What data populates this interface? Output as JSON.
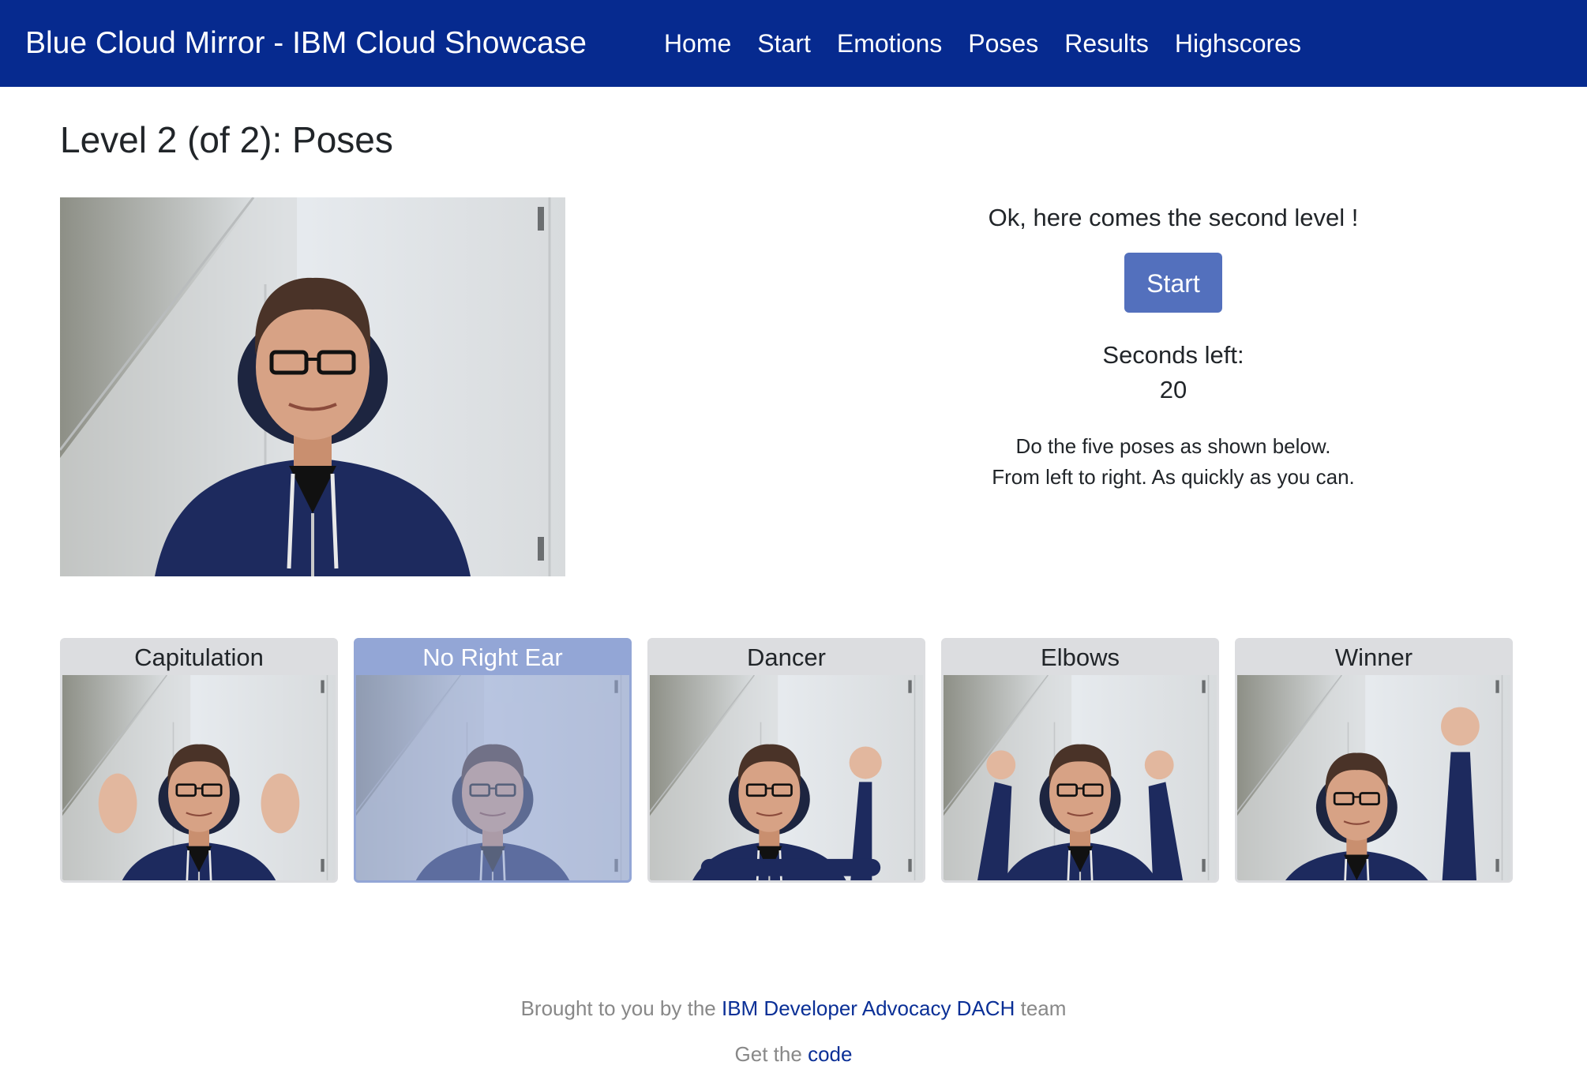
{
  "navbar": {
    "brand": "Blue Cloud Mirror - IBM Cloud Showcase",
    "links": [
      "Home",
      "Start",
      "Emotions",
      "Poses",
      "Results",
      "Highscores"
    ]
  },
  "page": {
    "title": "Level 2 (of 2): Poses"
  },
  "game": {
    "intro": "Ok, here comes the second level !",
    "start_label": "Start",
    "seconds_label": "Seconds left:",
    "seconds_value": "20",
    "instructions_line1": "Do the five poses as shown below.",
    "instructions_line2": "From left to right. As quickly as you can."
  },
  "poses": [
    {
      "label": "Capitulation",
      "active": false
    },
    {
      "label": "No Right Ear",
      "active": true
    },
    {
      "label": "Dancer",
      "active": false
    },
    {
      "label": "Elbows",
      "active": false
    },
    {
      "label": "Winner",
      "active": false
    }
  ],
  "footer": {
    "line1_prefix": "Brought to you by the",
    "line1_link": "IBM Developer Advocacy DACH",
    "line1_suffix": "team",
    "line2_prefix": "Get the",
    "line2_link": "code"
  },
  "colors": {
    "navbar": "#062a8f",
    "button": "#5370bd",
    "active_pose": "#93a6d6",
    "link": "#0a2f96"
  }
}
